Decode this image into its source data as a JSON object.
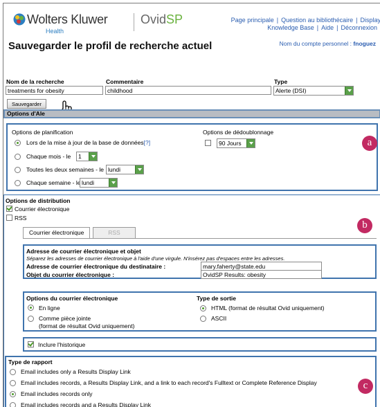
{
  "header": {
    "brand": "Wolters Kluwer",
    "brand_sub": "Health",
    "product_ovid": "Ovid",
    "product_sp": "SP",
    "nav_row1": [
      "Page principale",
      "Question au bibliothécaire",
      "Display"
    ],
    "nav_row2": [
      "Knowledge Base",
      "Aide",
      "Déconnexion"
    ],
    "account_label": "Nom du compte personnel :",
    "account_name": "fnoguez"
  },
  "page_title": "Sauvegarder le profil de recherche actuel",
  "form": {
    "name_label": "Nom de la recherche",
    "name_value": "treatments for obesity",
    "comment_label": "Commentaire",
    "comment_value": "childhood",
    "type_label": "Type",
    "type_value": "Alerte (DSI)",
    "save_button": "Sauvegarder"
  },
  "alert_section": {
    "header": "Options d'Ale",
    "scheduling": {
      "title": "Options de planification",
      "opt1": "Lors de la mise à jour de la base de données",
      "opt1_help": "[?]",
      "opt2": "Chaque mois - le",
      "opt2_value": "1",
      "opt3": "Toutes les deux semaines - le",
      "opt3_value": "lundi",
      "opt4": "Chaque semaine - le",
      "opt4_value": "lundi"
    },
    "dedup": {
      "title": "Options de dédoublonnage",
      "value": "90 Jours"
    }
  },
  "distribution": {
    "title": "Options de distribution",
    "email_checkbox": "Courrier électronique",
    "rss_checkbox": "RSS",
    "tabs": [
      "Courrier électronique",
      "RSS"
    ],
    "address_box": {
      "title": "Adresse de courrier électronique et objet",
      "note": "Séparez les adresses de courrier électronique à l'aide d'une virgule. N'insérez pas d'espaces entre les adresses.",
      "recipient_label": "Adresse de courrier électronique du destinataire :",
      "recipient_value": "mary.faherty@state.edu",
      "subject_label": "Objet du courrier électronique :",
      "subject_value": "OvidSP Results: obesity"
    },
    "email_options": {
      "title": "Options du courrier électronique",
      "online": "En ligne",
      "attachment": "Comme pièce jointe",
      "attachment_note": "(format de résultat Ovid uniquement)"
    },
    "output_type": {
      "title": "Type de sortie",
      "html": "HTML (format de résultat Ovid uniquement)",
      "ascii": "ASCII"
    },
    "include_history": "Inclure l'historique",
    "report_type": {
      "title": "Type de rapport",
      "options": [
        "Email includes only a Results Display Link",
        "Email includes records, a Results Display Link, and a link to each record's Fulltext or Complete Reference Display",
        "Email includes records only",
        "Email includes records and a Results Display Link"
      ]
    }
  },
  "markers": [
    "a",
    "b",
    "c"
  ],
  "colors": {
    "accent_blue": "#3f73ad",
    "marker": "#c22a62",
    "brand_green": "#6ab23e",
    "link": "#2a5db0"
  }
}
